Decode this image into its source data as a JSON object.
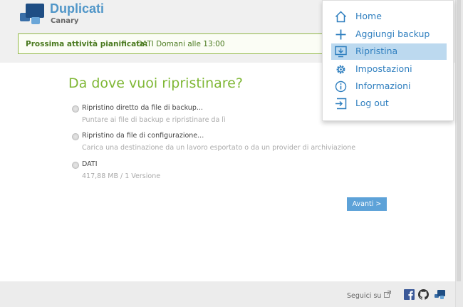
{
  "header": {
    "brand_title": "Duplicati",
    "brand_sub": "Canary",
    "schedule_label": "Prossima attività pianificata:",
    "schedule_value": "DATI Domani alle 13:00"
  },
  "main": {
    "title": "Da dove vuoi ripristinare?",
    "options": [
      {
        "title": "Ripristino diretto da file di backup...",
        "desc": "Puntare ai file di backup e ripristinare da lì"
      },
      {
        "title": "Ripristino da file di configurazione...",
        "desc": "Carica una destinazione da un lavoro esportato o da un provider di archiviazione"
      },
      {
        "title": "DATI",
        "desc": "417,88 MB / 1 Versione"
      }
    ],
    "next_label": "Avanti >"
  },
  "menu": {
    "items": [
      {
        "label": "Home",
        "icon": "home-icon"
      },
      {
        "label": "Aggiungi backup",
        "icon": "plus-icon"
      },
      {
        "label": "Ripristina",
        "icon": "restore-icon",
        "active": true
      },
      {
        "label": "Impostazioni",
        "icon": "gear-icon"
      },
      {
        "label": "Informazioni",
        "icon": "info-icon"
      },
      {
        "label": "Log out",
        "icon": "logout-icon"
      }
    ]
  },
  "footer": {
    "follow_label": "Seguici su"
  },
  "colors": {
    "accent_blue": "#2f7fbf",
    "title_green": "#7fb735",
    "schedule_green": "#4a7a1f",
    "menu_active": "#bcd9ef",
    "button_blue": "#5da2d8"
  }
}
